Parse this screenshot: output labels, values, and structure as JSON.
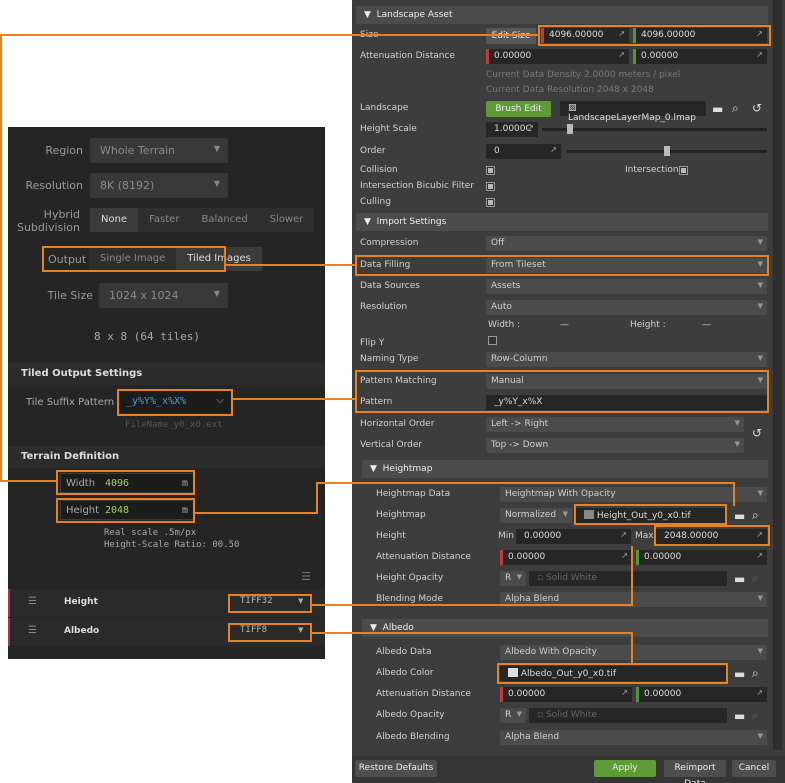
{
  "left": {
    "region": {
      "label": "Region",
      "value": "Whole Terrain"
    },
    "resolution": {
      "label": "Resolution",
      "value": "8K (8192)"
    },
    "hybrid": {
      "label_1": "Hybrid",
      "label_2": "Subdivision",
      "options": [
        "None",
        "Faster",
        "Balanced",
        "Slower"
      ],
      "selected": "None"
    },
    "output": {
      "label": "Output",
      "options": [
        "Single Image",
        "Tiled Images"
      ],
      "selected": "Tiled Images"
    },
    "tile_size": {
      "label": "Tile Size",
      "value": "1024 x 1024"
    },
    "tile_count": "8 x 8 (64 tiles)",
    "tiled_output_header": "Tiled Output Settings",
    "tile_suffix": {
      "label": "Tile Suffix Pattern",
      "value": "_y%Y%_x%X%",
      "hint": "FileName_y0_x0.ext"
    },
    "terrain_header": "Terrain Definition",
    "width": {
      "label": "Width",
      "value": "4096",
      "unit": "m"
    },
    "height": {
      "label": "Height",
      "value": "2048",
      "unit": "m"
    },
    "real_scale": "Real scale .5m/px",
    "height_scale_ratio": "Height-Scale Ratio: 00.50",
    "layers": [
      {
        "name": "Height",
        "format": "TIFF32"
      },
      {
        "name": "Albedo",
        "format": "TIFF8"
      }
    ]
  },
  "right": {
    "landscape_asset_header": "Landscape Asset",
    "size": {
      "label": "Size",
      "button": "Edit Size",
      "x": "4096.00000",
      "y": "4096.00000"
    },
    "attenuation": {
      "label": "Attenuation Distance",
      "a": "0.00000",
      "b": "0.00000"
    },
    "density_note": "Current Data Density 2.0000 meters / pixel",
    "resolution_note": "Current Data Resolution 2048 x 2048",
    "landscape": {
      "label": "Landscape",
      "button": "Brush Edit",
      "value": "LandscapeLayerMap_0.lmap"
    },
    "height_scale": {
      "label": "Height Scale",
      "value": "1.0000C"
    },
    "order": {
      "label": "Order",
      "value": "0"
    },
    "collision": {
      "label": "Collision",
      "checked": true
    },
    "intersection": {
      "label": "Intersection",
      "checked": true
    },
    "bicubic": {
      "label": "Intersection Bicubic Filter",
      "checked": true
    },
    "culling": {
      "label": "Culling",
      "checked": true
    },
    "import_header": "Import Settings",
    "compression": {
      "label": "Compression",
      "value": "Off"
    },
    "data_filling": {
      "label": "Data Filling",
      "value": "From Tileset"
    },
    "data_sources": {
      "label": "Data Sources",
      "value": "Assets"
    },
    "resolution": {
      "label": "Resolution",
      "value": "Auto"
    },
    "wh": {
      "width_label": "Width :",
      "width_value": "—",
      "height_label": "Height :",
      "height_value": "—"
    },
    "flip_y": {
      "label": "Flip Y",
      "checked": false
    },
    "naming_type": {
      "label": "Naming Type",
      "value": "Row-Column"
    },
    "pattern_matching": {
      "label": "Pattern Matching",
      "value": "Manual"
    },
    "pattern": {
      "label": "Pattern",
      "value": "_y%Y_x%X"
    },
    "horizontal_order": {
      "label": "Horizontal Order",
      "value": "Left -> Right"
    },
    "vertical_order": {
      "label": "Vertical Order",
      "value": "Top -> Down"
    },
    "heightmap_header": "Heightmap",
    "heightmap_data": {
      "label": "Heightmap Data",
      "value": "Heightmap With Opacity"
    },
    "heightmap": {
      "label": "Heightmap",
      "mode": "Normalized",
      "file": "Height_Out_y0_x0.tif"
    },
    "height": {
      "label": "Height",
      "min_label": "Min",
      "min": "0.00000",
      "max_label": "Max",
      "max": "2048.00000"
    },
    "hm_attenuation": {
      "label": "Attenuation Distance",
      "a": "0.00000",
      "b": "0.00000"
    },
    "height_opacity": {
      "label": "Height Opacity",
      "channel": "R",
      "value": "Solid White"
    },
    "blending_mode": {
      "label": "Blending Mode",
      "value": "Alpha Blend"
    },
    "albedo_header": "Albedo",
    "albedo_data": {
      "label": "Albedo Data",
      "value": "Albedo With Opacity"
    },
    "albedo_color": {
      "label": "Albedo Color",
      "file": "Albedo_Out_y0_x0.tif"
    },
    "al_attenuation": {
      "label": "Attenuation Distance",
      "a": "0.00000",
      "b": "0.00000"
    },
    "albedo_opacity": {
      "label": "Albedo Opacity",
      "channel": "R",
      "value": "Solid White"
    },
    "albedo_blending": {
      "label": "Albedo Blending",
      "value": "Alpha Blend"
    },
    "footer": {
      "restore": "Restore Defaults",
      "apply": "Apply",
      "reimport": "Reimport Data",
      "cancel": "Cancel"
    }
  },
  "colors": {
    "accent": "#e8821f",
    "apply": "#5e9a35",
    "red_axis": "#c43b3b",
    "green_axis": "#4a9a3a"
  }
}
